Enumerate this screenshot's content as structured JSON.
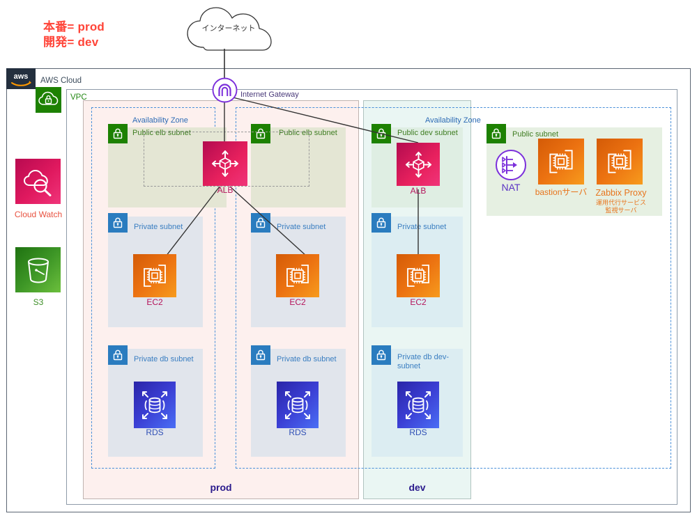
{
  "annotation": {
    "line1": "本番= prod",
    "line2": "開発= dev",
    "color": "#ff4438"
  },
  "internet": {
    "label": "インターネット",
    "icon": "cloud-icon"
  },
  "aws_cloud": {
    "label": "AWS Cloud",
    "logo": "aws-logo",
    "icon": "aws-cloud-icon"
  },
  "vpc": {
    "label": "VPC"
  },
  "internet_gateway": {
    "label": "Internet Gateway",
    "icon": "internet-gateway-icon",
    "color": "#7b2fdb"
  },
  "sidebar_services": [
    {
      "id": "cloudwatch",
      "label": "Cloud Watch",
      "icon": "cloudwatch-icon",
      "color": "#e8513f"
    },
    {
      "id": "s3",
      "label": "S3",
      "icon": "s3-bucket-icon",
      "color": "#3d8f26"
    }
  ],
  "availability_zones": [
    {
      "id": "az-prod-1",
      "label": "Availability Zone"
    },
    {
      "id": "az-right",
      "label": "Availability Zone"
    }
  ],
  "environments": [
    {
      "id": "prod",
      "label": "prod",
      "color": "#2a1a8c"
    },
    {
      "id": "dev",
      "label": "dev",
      "color": "#2a1a8c"
    }
  ],
  "subnets": [
    {
      "id": "public-elb-subnet-1",
      "label": "Public elb subnet",
      "type": "public",
      "env": "prod"
    },
    {
      "id": "public-elb-subnet-2",
      "label": "Public elb subnet",
      "type": "public",
      "env": "prod"
    },
    {
      "id": "public-dev-subnet",
      "label": "Public dev subnet",
      "type": "public",
      "env": "dev"
    },
    {
      "id": "public-subnet",
      "label": "Public subnet",
      "type": "public",
      "env": "shared"
    },
    {
      "id": "private-subnet-1",
      "label": "Private subnet",
      "type": "private",
      "env": "prod"
    },
    {
      "id": "private-subnet-2",
      "label": "Private subnet",
      "type": "private",
      "env": "prod"
    },
    {
      "id": "private-subnet-dev",
      "label": "Private subnet",
      "type": "private",
      "env": "dev"
    },
    {
      "id": "private-db-subnet-1",
      "label": "Private db subnet",
      "type": "private",
      "env": "prod"
    },
    {
      "id": "private-db-subnet-2",
      "label": "Private db subnet",
      "type": "private",
      "env": "prod"
    },
    {
      "id": "private-db-dev-subnet",
      "label": "Private db dev-subnet",
      "type": "private",
      "env": "dev"
    }
  ],
  "services": [
    {
      "id": "alb-prod",
      "label": "ALB",
      "icon": "alb-icon"
    },
    {
      "id": "alb-dev",
      "label": "ALB",
      "icon": "alb-icon"
    },
    {
      "id": "ec2-prod-1",
      "label": "EC2",
      "icon": "ec2-icon"
    },
    {
      "id": "ec2-prod-2",
      "label": "EC2",
      "icon": "ec2-icon"
    },
    {
      "id": "ec2-dev",
      "label": "EC2",
      "icon": "ec2-icon"
    },
    {
      "id": "rds-prod-1",
      "label": "RDS",
      "icon": "rds-icon"
    },
    {
      "id": "rds-prod-2",
      "label": "RDS",
      "icon": "rds-icon"
    },
    {
      "id": "rds-dev",
      "label": "RDS",
      "icon": "rds-icon"
    },
    {
      "id": "nat",
      "label": "NAT",
      "icon": "nat-gateway-icon"
    },
    {
      "id": "bastion",
      "label": "bastionサーバ",
      "icon": "ec2-icon"
    },
    {
      "id": "zabbix-proxy",
      "label": "Zabbix Proxy",
      "sub_line1": "運用代行サービス",
      "sub_line2": "監視サーバ",
      "icon": "ec2-icon"
    }
  ],
  "colors": {
    "alb": "#e8215e",
    "ec2": "#ec7211",
    "rds": "#3b3fd4",
    "s3": "#3d9626",
    "cloudwatch": "#e0195f",
    "lock_green": "#1d8102",
    "lock_blue": "#2a7cbf",
    "az_dash": "#4a90d9",
    "prod_bg": "#fdf0ee",
    "dev_bg": "#eaf6f3"
  }
}
